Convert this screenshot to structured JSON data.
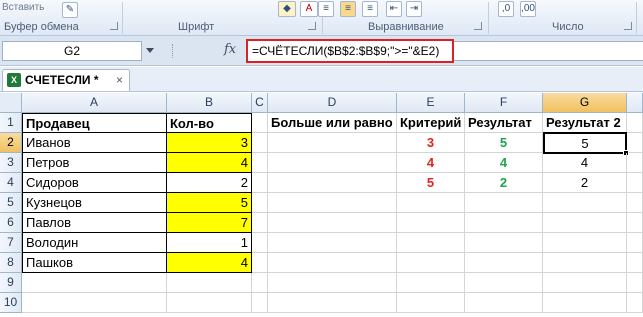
{
  "ribbon": {
    "paste_label": "Вставить",
    "groups": [
      {
        "label": "Буфер обмена"
      },
      {
        "label": "Шрифт"
      },
      {
        "label": "Выравнивание"
      },
      {
        "label": "Число"
      }
    ]
  },
  "formula_bar": {
    "name_box": "G2",
    "fx_symbol": "fx",
    "formula": "=СЧЁТЕСЛИ($B$2:$B$9;\">=\"&E2)"
  },
  "tab": {
    "icon": "excel-file-icon",
    "label": "СЧЕТЕСЛИ *",
    "close": "×"
  },
  "columns": [
    "A",
    "B",
    "C",
    "D",
    "E",
    "F",
    "G"
  ],
  "rows": [
    "1",
    "2",
    "3",
    "4",
    "5",
    "6",
    "7",
    "8",
    "9",
    "10"
  ],
  "headers": {
    "a1": "Продавец",
    "b1": "Кол-во",
    "d1": "Больше или равно",
    "e1": "Критерий",
    "f1": "Результат",
    "g1": "Результат 2"
  },
  "sellers": [
    {
      "name": "Иванов",
      "qty": "3",
      "highlight": true
    },
    {
      "name": "Петров",
      "qty": "4",
      "highlight": true
    },
    {
      "name": "Сидоров",
      "qty": "2",
      "highlight": false
    },
    {
      "name": "Кузнецов",
      "qty": "5",
      "highlight": true
    },
    {
      "name": "Павлов",
      "qty": "7",
      "highlight": true
    },
    {
      "name": "Володин",
      "qty": "1",
      "highlight": false
    },
    {
      "name": "Пашков",
      "qty": "4",
      "highlight": true
    }
  ],
  "criteria": [
    {
      "criterion": "3",
      "result": "5",
      "result2": "5"
    },
    {
      "criterion": "4",
      "result": "4",
      "result2": "4"
    },
    {
      "criterion": "5",
      "result": "2",
      "result2": "2"
    }
  ],
  "selected_cell": "G2",
  "colors": {
    "highlight": "#ffff00",
    "criterion_text": "#e0261b",
    "result_text": "#1ea44a",
    "formula_outline": "#e02020"
  }
}
